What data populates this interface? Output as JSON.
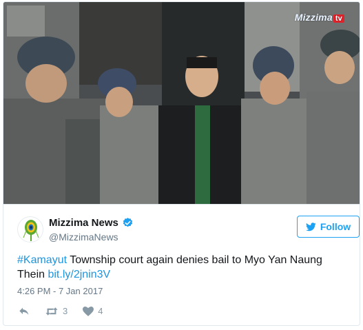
{
  "media": {
    "watermark_brand": "Mizzima",
    "watermark_suffix": "tv"
  },
  "author": {
    "display_name": "Mizzima News",
    "handle": "@MizzimaNews",
    "verified": true,
    "avatar_icon": "peacock-feather-logo"
  },
  "follow_button": {
    "label": "Follow",
    "icon": "twitter-bird-icon"
  },
  "tweet": {
    "hashtag": "#Kamayut",
    "text_line1_rest": " Township court again denies bail to Myo Yan Naung",
    "text_line2": "Thein ",
    "link": "bit.ly/2jnin3V",
    "timestamp": "4:26 PM - 7 Jan 2017"
  },
  "actions": {
    "reply_icon": "reply-icon",
    "retweet_icon": "retweet-icon",
    "retweet_count": "3",
    "like_icon": "heart-icon",
    "like_count": "4"
  },
  "colors": {
    "link_blue": "#1b95e0",
    "twitter_blue": "#1da1f2",
    "meta_gray": "#657786",
    "action_gray": "#8899a6"
  }
}
